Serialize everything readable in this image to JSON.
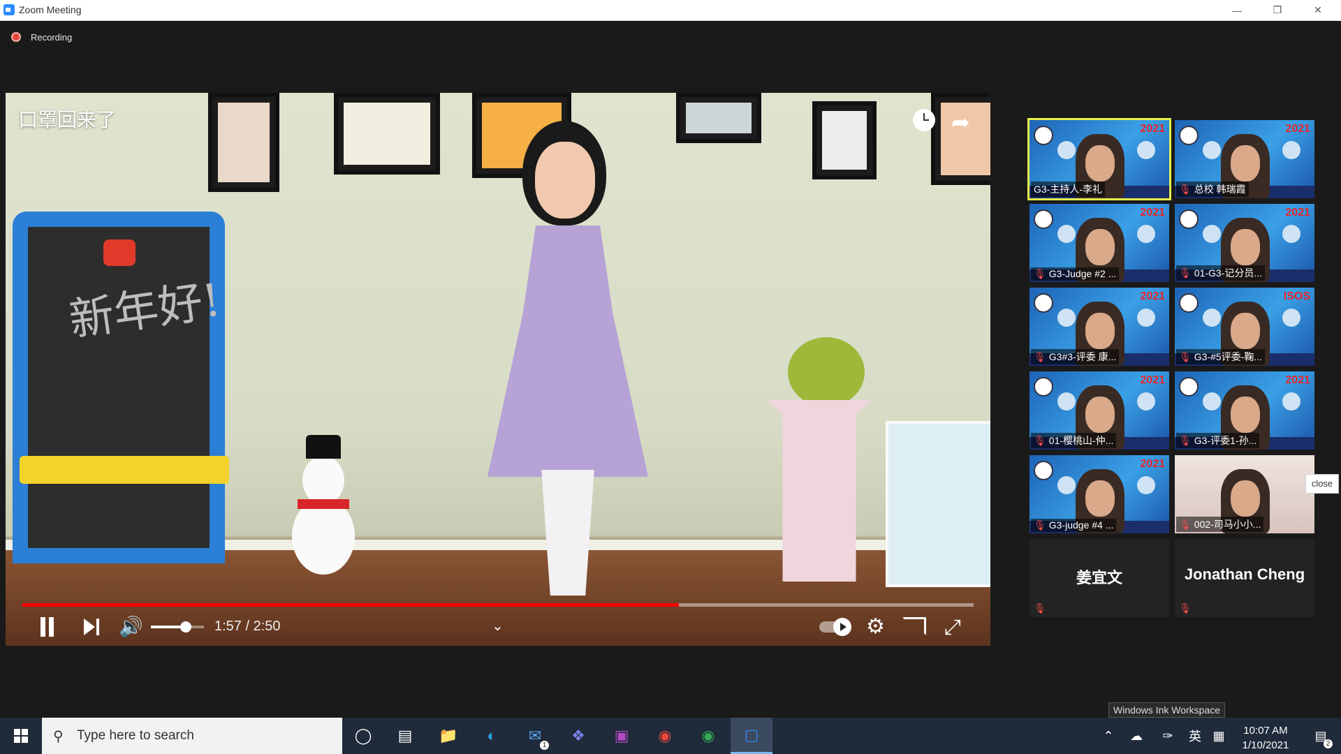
{
  "window": {
    "title": "Zoom Meeting"
  },
  "recording": {
    "label": "Recording"
  },
  "video": {
    "title": "口罩回来了",
    "chalkboard_text": "新年好!",
    "time_display": "1:57 / 2:50",
    "progress_fraction": 0.69,
    "volume_fraction": 0.55
  },
  "gallery": {
    "participants": [
      {
        "name": "G3-主持人-李礼",
        "muted": false,
        "speaking": true
      },
      {
        "name": "总校 韩瑞霞",
        "muted": true,
        "speaking": false
      },
      {
        "name": "G3-Judge #2 ...",
        "muted": true,
        "speaking": false
      },
      {
        "name": "01-G3-记分员...",
        "muted": true,
        "speaking": false
      },
      {
        "name": "G3#3-评委 康...",
        "muted": true,
        "speaking": false
      },
      {
        "name": "G3-#5评委-鞠...",
        "muted": true,
        "speaking": false
      },
      {
        "name": "01-樱桃山-仲...",
        "muted": true,
        "speaking": false
      },
      {
        "name": "G3-评委1-孙...",
        "muted": true,
        "speaking": false
      },
      {
        "name": "G3-judge #4 ...",
        "muted": true,
        "speaking": false
      },
      {
        "name": "002-司马小小...",
        "muted": true,
        "speaking": false
      },
      {
        "name": "姜宜文",
        "muted": true,
        "speaking": false
      },
      {
        "name": "Jonathan Cheng",
        "muted": true,
        "speaking": false
      }
    ],
    "tile_year": "2021",
    "tile_banner": "ISOS"
  },
  "tooltips": {
    "close": "close",
    "ink": "Windows Ink Workspace"
  },
  "taskbar": {
    "search_placeholder": "Type here to search",
    "mail_badge": "1",
    "clock_time": "10:07 AM",
    "clock_date": "1/10/2021",
    "ime_label": "英",
    "notification_count": "2"
  }
}
